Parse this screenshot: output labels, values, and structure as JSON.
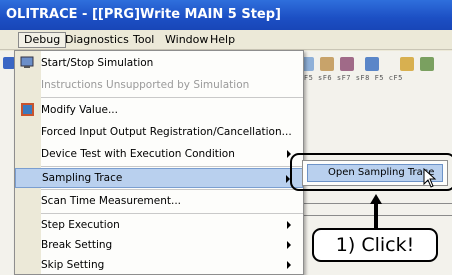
{
  "window": {
    "title": "OLITRACE - [[PRG]Write MAIN 5 Step]"
  },
  "menubar": {
    "items": [
      {
        "label": "Debug",
        "active": true
      },
      {
        "label": "Diagnostics"
      },
      {
        "label": "Tool"
      },
      {
        "label": "Window"
      },
      {
        "label": "Help"
      }
    ]
  },
  "toolbar": {
    "strip_text": "F8  sF5 sF6 sF7 sF8  F5 cF5"
  },
  "debug_menu": {
    "items": [
      {
        "label": "Start/Stop Simulation",
        "disabled": false,
        "icon": "simulation-icon"
      },
      {
        "label": "Instructions Unsupported by Simulation",
        "disabled": true
      },
      {
        "label": "Modify Value...",
        "disabled": false,
        "icon": "modify-value-icon"
      },
      {
        "label": "Forced Input Output Registration/Cancellation...",
        "disabled": false
      },
      {
        "label": "Device Test with Execution Condition",
        "disabled": false,
        "submenu": true
      },
      {
        "label": "Sampling Trace",
        "disabled": false,
        "submenu": true,
        "highlight": true
      },
      {
        "label": "Scan Time Measurement...",
        "disabled": false
      },
      {
        "label": "Step Execution",
        "disabled": false,
        "submenu": true
      },
      {
        "label": "Break Setting",
        "disabled": false,
        "submenu": true
      },
      {
        "label": "Skip Setting",
        "disabled": false,
        "submenu": true
      }
    ]
  },
  "sampling_trace_submenu": {
    "items": [
      {
        "label": "Open Sampling Trace"
      }
    ]
  },
  "annotation": {
    "text": "1) Click!"
  }
}
